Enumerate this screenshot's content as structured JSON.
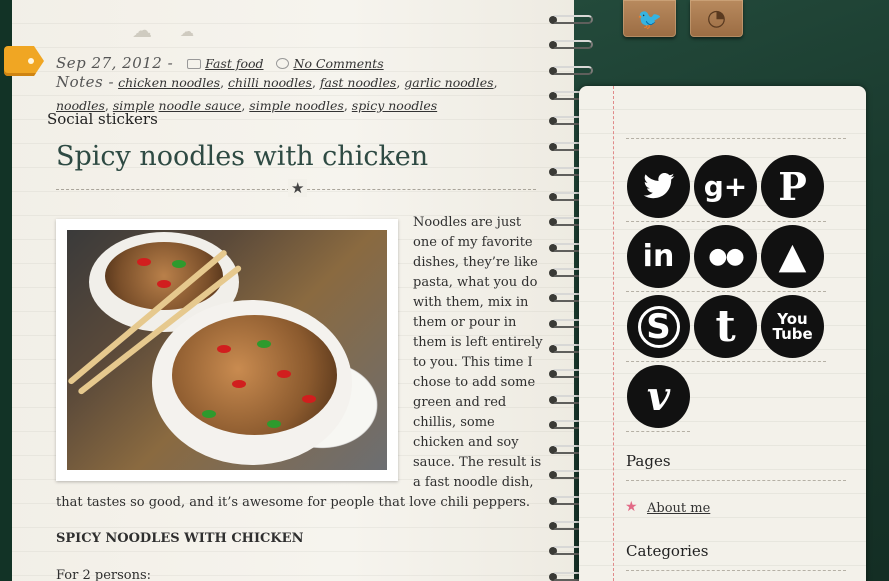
{
  "post": {
    "date": "Sep 27, 2012 -",
    "category": "Fast food",
    "comments": "No Comments",
    "notes_label": "Notes -",
    "tags": [
      "chicken noodles",
      "chilli noodles",
      "fast noodles",
      "garlic noodles",
      "noodles",
      "simple",
      "noodle sauce",
      "simple noodles",
      "spicy noodles"
    ],
    "title": "Spicy noodles with chicken",
    "intro": "Noodles are just one of my favorite dishes, they’re like pasta, what you do with them, mix in them or pour in them is left entirely to you. This time I chose to add some green and red chillis, some chicken and soy sauce. The result is a fast noodle dish,",
    "intro_cont": "that tastes so good, and it’s awesome for people that love chili peppers.",
    "recipe_heading": "SPICY NOODLES WITH CHICKEN",
    "persons": "For 2 persons:"
  },
  "top_buttons": {
    "twitter_icon": "bird-icon",
    "rss_icon": "rss-icon"
  },
  "sidebar": {
    "social_title": "Social stickers",
    "stickers": [
      {
        "name": "twitter",
        "glyph": "🐦"
      },
      {
        "name": "google-plus",
        "glyph": "g+"
      },
      {
        "name": "pinterest",
        "glyph": "P"
      },
      {
        "name": "linkedin",
        "glyph": "in"
      },
      {
        "name": "flickr",
        "glyph": "●●"
      },
      {
        "name": "forrst",
        "glyph": "▲"
      },
      {
        "name": "skype",
        "glyph": "S"
      },
      {
        "name": "tumblr",
        "glyph": "t"
      },
      {
        "name": "youtube",
        "glyph": "You Tube"
      },
      {
        "name": "vimeo",
        "glyph": "v"
      }
    ],
    "pages_title": "Pages",
    "pages": [
      "About me"
    ],
    "categories_title": "Categories"
  }
}
